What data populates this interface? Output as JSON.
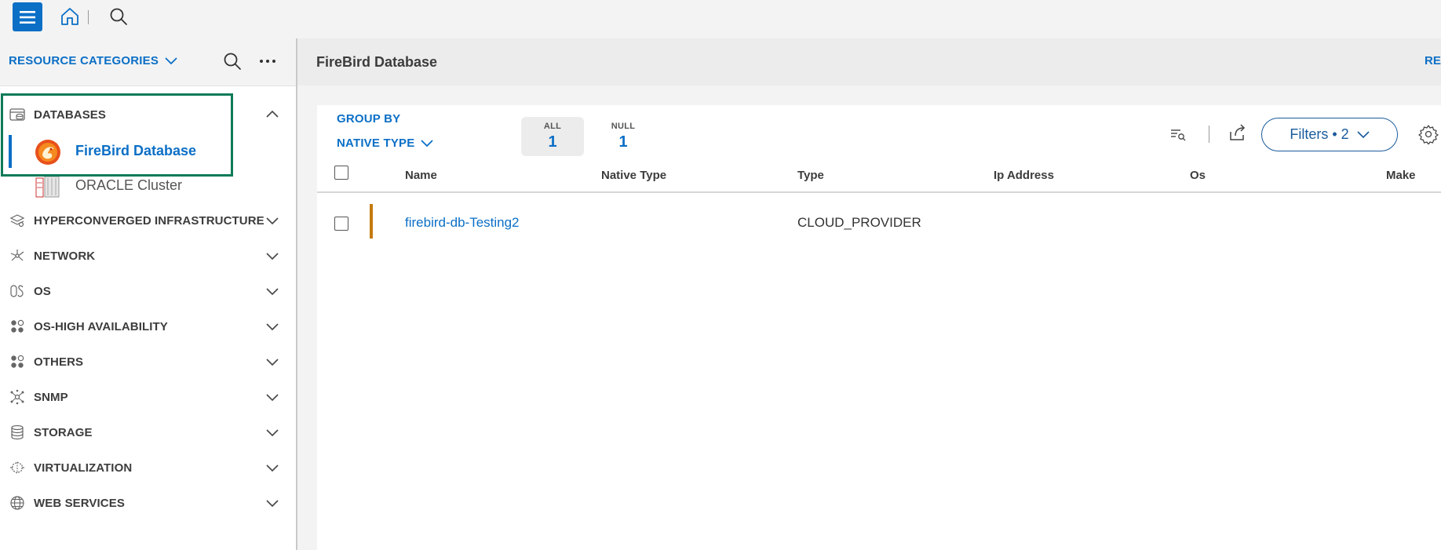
{
  "topbar": {
    "menu_icon": "hamburger-icon",
    "home_icon": "home-icon",
    "search_icon": "search-icon"
  },
  "sidebar": {
    "title": "RESOURCE CATEGORIES",
    "categories": [
      {
        "label": "DATABASES",
        "icon": "database-icon",
        "expanded": true,
        "children": [
          {
            "label": "FireBird Database",
            "icon": "firebird-icon",
            "active": true
          },
          {
            "label": "ORACLE Cluster",
            "icon": "oracle-cluster-icon",
            "active": false
          }
        ]
      },
      {
        "label": "HYPERCONVERGED INFRASTRUCTURE",
        "icon": "hyperconverged-icon",
        "expanded": false
      },
      {
        "label": "NETWORK",
        "icon": "network-icon",
        "expanded": false
      },
      {
        "label": "OS",
        "icon": "os-icon",
        "expanded": false
      },
      {
        "label": "OS-HIGH AVAILABILITY",
        "icon": "ha-icon",
        "expanded": false
      },
      {
        "label": "OTHERS",
        "icon": "others-icon",
        "expanded": false
      },
      {
        "label": "SNMP",
        "icon": "snmp-icon",
        "expanded": false
      },
      {
        "label": "STORAGE",
        "icon": "storage-icon",
        "expanded": false
      },
      {
        "label": "VIRTUALIZATION",
        "icon": "virtualization-icon",
        "expanded": false
      },
      {
        "label": "WEB SERVICES",
        "icon": "globe-icon",
        "expanded": false
      }
    ]
  },
  "main": {
    "title": "FireBird Database",
    "action_link": "RE",
    "group_by": {
      "label": "GROUP BY",
      "value": "NATIVE TYPE"
    },
    "counts": [
      {
        "label": "ALL",
        "value": "1",
        "selected": true
      },
      {
        "label": "NULL",
        "value": "1",
        "selected": false
      }
    ],
    "filters_label": "Filters • 2",
    "table": {
      "columns": [
        "Name",
        "Native Type",
        "Type",
        "Ip Address",
        "Os",
        "Make"
      ],
      "rows": [
        {
          "name": "firebird-db-Testing2",
          "native_type": "",
          "type": "CLOUD_PROVIDER",
          "ip": "",
          "os": "",
          "make": ""
        }
      ]
    }
  },
  "colors": {
    "accent": "#0b6fc6",
    "highlight": "#0e7a5a",
    "row_flag": "#c47a10"
  }
}
